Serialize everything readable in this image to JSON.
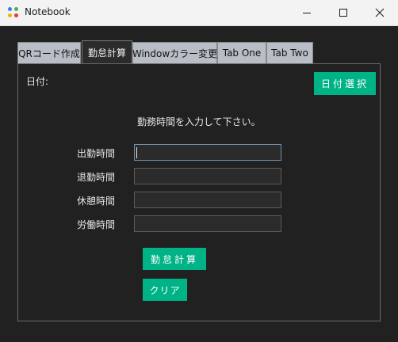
{
  "window": {
    "title": "Notebook"
  },
  "tabs": [
    {
      "label": "QRコード作成"
    },
    {
      "label": "勤怠計算"
    },
    {
      "label": "Windowカラー変更"
    },
    {
      "label": "Tab One"
    },
    {
      "label": "Tab Two"
    }
  ],
  "panel": {
    "date_label": "日付:",
    "date_button": "日付選択",
    "instruction": "勤務時間を入力して下さい。",
    "fields": [
      {
        "label": "出勤時間",
        "value": ""
      },
      {
        "label": "退勤時間",
        "value": ""
      },
      {
        "label": "休憩時間",
        "value": ""
      },
      {
        "label": "労働時間",
        "value": ""
      }
    ],
    "calc_button": "勤怠計算",
    "clear_button": "クリア"
  },
  "colors": {
    "accent": "#00b386",
    "background": "#212121",
    "titlebar": "#f3f3f3"
  },
  "icons": [
    "app-icon",
    "minimize-icon",
    "maximize-icon",
    "close-icon"
  ]
}
